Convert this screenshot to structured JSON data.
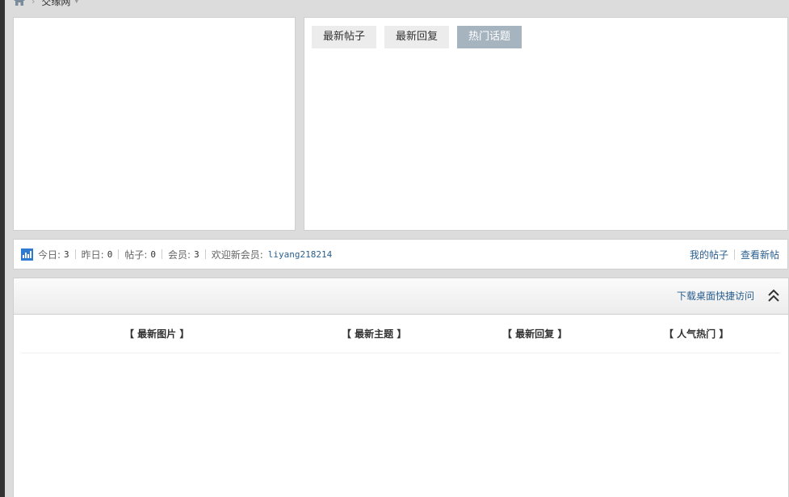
{
  "breadcrumb": {
    "home_icon": "home-icon",
    "site_name": "交缘网"
  },
  "tabs": [
    {
      "label": "最新帖子",
      "active": false
    },
    {
      "label": "最新回复",
      "active": false
    },
    {
      "label": "热门话题",
      "active": true
    }
  ],
  "stats": {
    "icon": "bar-chart-icon",
    "today_label": "今日:",
    "today_value": "3",
    "yesterday_label": "昨日:",
    "yesterday_value": "0",
    "posts_label": "帖子:",
    "posts_value": "0",
    "members_label": "会员:",
    "members_value": "3",
    "welcome_label": "欢迎新会员:",
    "new_member": "liyang218214",
    "my_posts_link": "我的帖子",
    "new_posts_link": "查看新帖"
  },
  "bottom": {
    "shortcut_link": "下载桌面快捷访问",
    "collapse_icon": "double-chevron-up-icon",
    "sections": [
      "【 最新图片 】",
      "【 最新主题 】",
      "【 最新回复 】",
      "【 人气热门 】"
    ]
  },
  "colors": {
    "accent_link": "#2a5f8f",
    "active_tab": "#a6b4c0",
    "stats_icon": "#2e7ad0"
  }
}
